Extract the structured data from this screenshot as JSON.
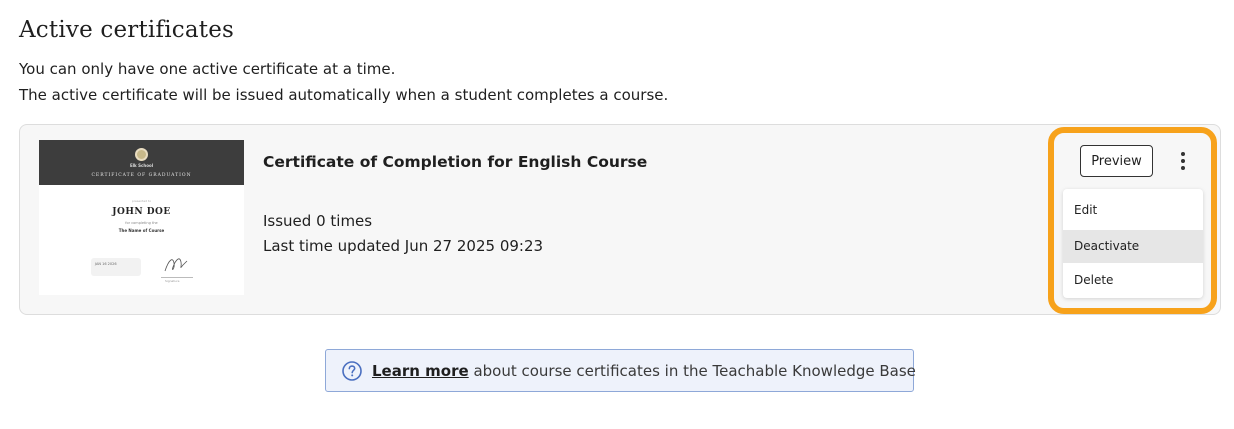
{
  "section": {
    "title": "Active certificates",
    "description_line1": "You can only have one active certificate at a time.",
    "description_line2": "The active certificate will be issued automatically when a student completes a course."
  },
  "certificate": {
    "title": "Certificate of Completion for English Course",
    "issued": "Issued 0 times",
    "last_updated": "Last time updated Jun 27 2025 09:23",
    "thumbnail": {
      "school_name": "Elk School",
      "header": "CERTIFICATE OF GRADUATION",
      "presented_to": "presented to",
      "recipient": "JOHN DOE",
      "for_completing": "for completing the",
      "course": "The Name of Course",
      "date": "JAN 16 2026",
      "signature_name": "Signature"
    }
  },
  "actions": {
    "preview_label": "Preview",
    "menu": {
      "items": [
        {
          "label": "Edit"
        },
        {
          "label": "Deactivate",
          "hovered": true
        },
        {
          "label": "Delete"
        }
      ]
    }
  },
  "knowledge_base": {
    "link_text": "Learn more",
    "text": " about course certificates in the Teachable Knowledge Base"
  },
  "colors": {
    "highlight": "#f7a21b",
    "banner_bg": "#eef2fb",
    "banner_border": "#8ea8d8",
    "info_icon": "#4a6fc0"
  }
}
